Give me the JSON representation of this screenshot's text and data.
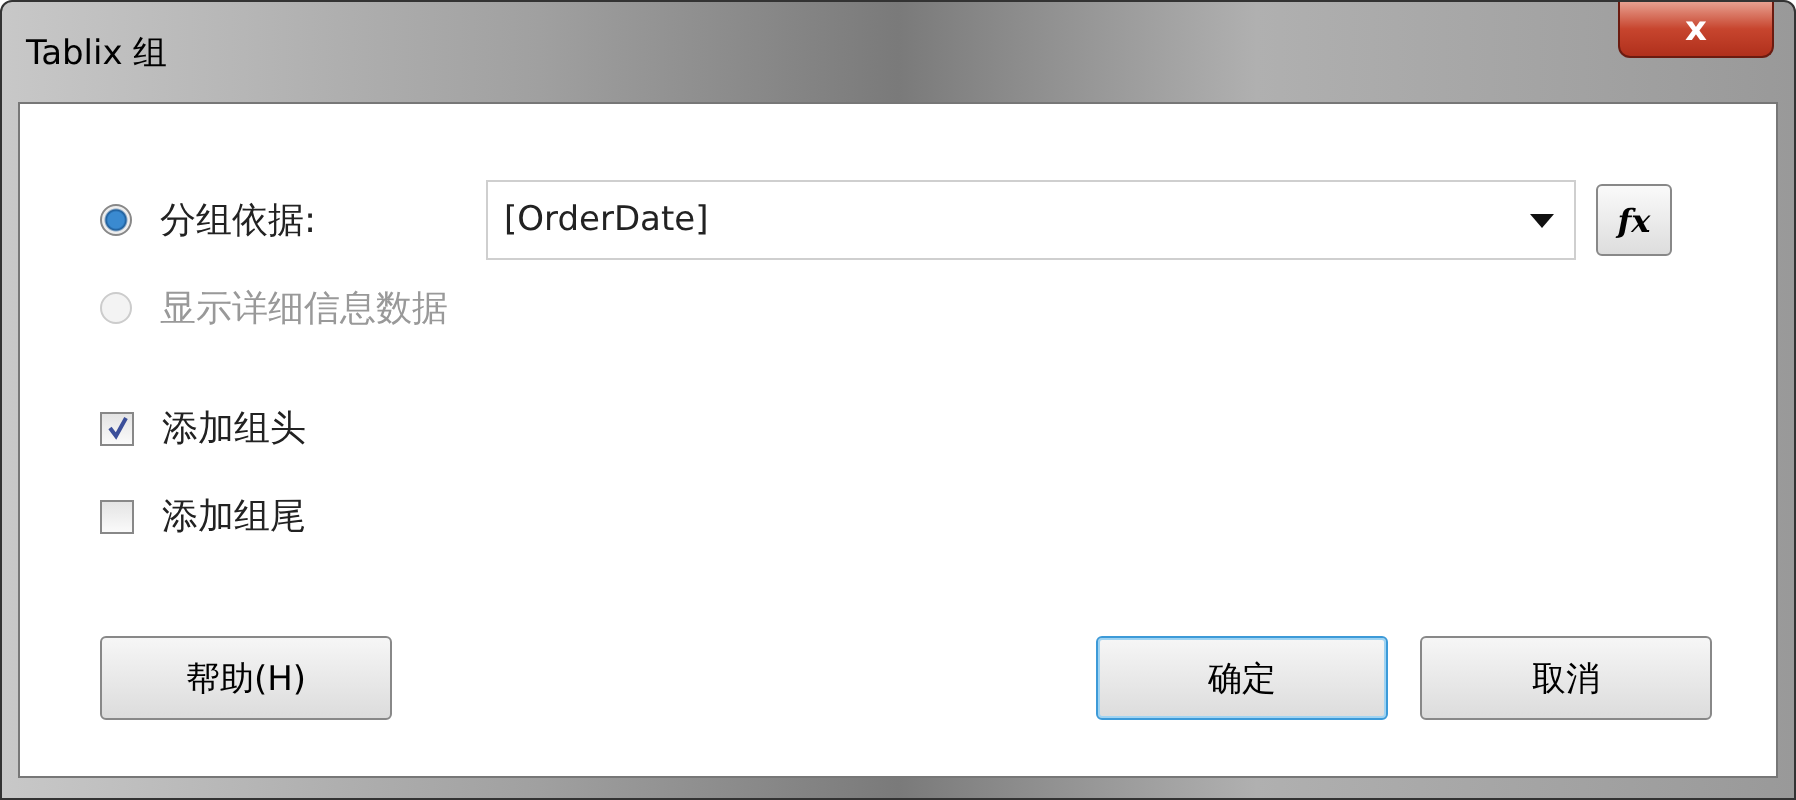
{
  "window": {
    "title": "Tablix 组",
    "close": "x"
  },
  "group_options": [
    {
      "label": "分组依据:",
      "selected": true,
      "disabled": false
    },
    {
      "label": "显示详细信息数据",
      "selected": false,
      "disabled": true
    }
  ],
  "group_expression": {
    "value": "[OrderDate]",
    "function_button": "fx"
  },
  "checkboxes": [
    {
      "label": "添加组头",
      "checked": true
    },
    {
      "label": "添加组尾",
      "checked": false
    }
  ],
  "buttons": [
    {
      "label": "帮助(H)",
      "kind": "help",
      "default": false
    },
    {
      "label": "确定",
      "kind": "ok",
      "default": true
    },
    {
      "label": "取消",
      "kind": "cancel",
      "default": false
    }
  ]
}
